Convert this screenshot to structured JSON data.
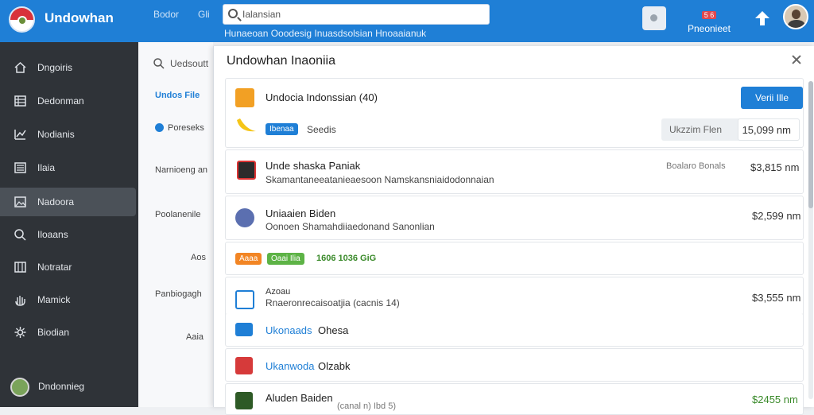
{
  "header": {
    "app_title": "Undowhan",
    "links": [
      "Bodor",
      "Gli"
    ],
    "search_value": "Ialansian",
    "sub_nav": "Hunaeoan Ooodesig  Inuasdsolsian Hnoaaianuk",
    "notif_badge": "5 6",
    "notif_label": "Pneonieet"
  },
  "sidebar": {
    "items": [
      {
        "label": "Dngoiris",
        "icon": "home-icon"
      },
      {
        "label": "Dedonman",
        "icon": "grid-icon"
      },
      {
        "label": "Nodianis",
        "icon": "chart-icon"
      },
      {
        "label": "Ilaia",
        "icon": "list-icon"
      },
      {
        "label": "Nadoora",
        "icon": "image-icon"
      },
      {
        "label": "Iloaans",
        "icon": "search-icon"
      },
      {
        "label": "Notratar",
        "icon": "columns-icon"
      },
      {
        "label": "Mamick",
        "icon": "hand-icon"
      },
      {
        "label": "Biodian",
        "icon": "gear-icon"
      }
    ],
    "active_index": 4,
    "footer_label": "Dndonnieg"
  },
  "filters": {
    "search_label": "Uedsoutt",
    "items": [
      "Undos File",
      "Poreseks",
      "Narnioeng an",
      "Poolanenile",
      "Aos",
      "Panbiogagh",
      "Aaia"
    ]
  },
  "panel": {
    "title": "Undowhan Inaoniia",
    "cards": [
      {
        "title": "Undocia Indonssian (40)",
        "button": "Verii Ille",
        "tag": "Ibenaa",
        "sub": "Seedis",
        "size_label": "Ukzzim Flen",
        "size_value": "15,099 nm"
      },
      {
        "title": "Unde shaska Paniak",
        "sub": "Skamantaneeatanieaesoon Namskansniaidodonnaian",
        "meta": "Boalaro Bonals",
        "price": "$3,815 nm"
      },
      {
        "title": "Uniaaien Biden",
        "sub": "Oonoen Shamahdiiaedonand Sanonlian",
        "price": "$2,599 nm"
      },
      {
        "tags": [
          "Aaaa",
          "Oaai Ilia"
        ],
        "label": "1606 1036 GiG"
      },
      {
        "title": "Azoau",
        "sub": "Rnaeronrecaisoatjia (cacnis 14)",
        "price": "$3,555 nm"
      },
      {
        "link": "Ukonaads",
        "text": "Ohesa"
      },
      {
        "link": "Ukanwoda",
        "text": "Olzabk"
      },
      {
        "title": "Aluden Baiden",
        "sub": "(canal n) Ibd 5)",
        "price": "$2455 nm"
      }
    ]
  },
  "colors": {
    "brand": "#1f7fd6",
    "sidebar": "#2f3338",
    "accent_orange": "#f2a024",
    "accent_green": "#5db346",
    "danger": "#e0484e"
  }
}
